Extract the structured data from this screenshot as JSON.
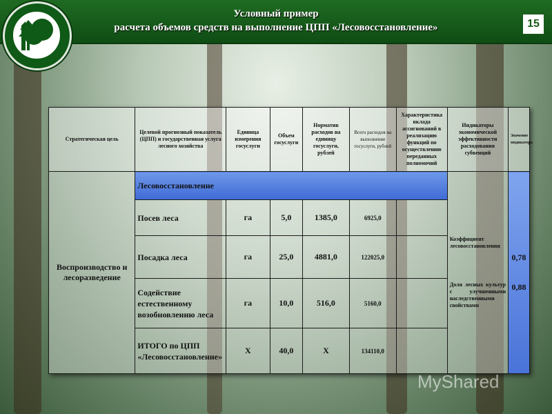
{
  "header": {
    "title_line1": "Условный пример",
    "title_line2": "расчета объемов средств на выполнение  ЦПП «Лесовосстановление»",
    "page_number": "15"
  },
  "table": {
    "columns": [
      "Стратегическая цель",
      "Целевой прогнозный показатель (ЦПП) и государственная услуга лесного хозяйства",
      "Единица измерения госуслуги",
      "Объем госуслуги",
      "Норматив расходов на единицу госуслуги, рублей",
      "Всего расходов на выполнение госуслуги, рублей",
      "Характеристика вклада ассигнований в реализацию функций по осуществлению переданных полномочий",
      "Индикаторы экономической эффективности расходования субвенций",
      "Значение индикатора"
    ],
    "goal": "Воспроизводство и лесоразведение",
    "section_title": "Лесовосстановление",
    "rows": [
      {
        "name": "Посев  леса",
        "unit": "га",
        "volume": "5,0",
        "norm": "1385,0",
        "total": "6925,0"
      },
      {
        "name": "Посадка леса",
        "unit": "га",
        "volume": "25,0",
        "norm": "4881,0",
        "total": "122025,0"
      },
      {
        "name": "Содействие естественному возобновлению леса",
        "unit": "га",
        "volume": "10,0",
        "norm": "516,0",
        "total": "5160,0"
      },
      {
        "name": "ИТОГО по ЦПП «Лесовосстановление»",
        "unit": "Х",
        "volume": "40,0",
        "norm": "Х",
        "total": "134110,0"
      }
    ],
    "indicators": [
      {
        "label": "Коэффициент лесовосстановления",
        "value": "0,78"
      },
      {
        "label": "Доля лесных культур с улучшенными наследственными свойствами",
        "value": "0,88"
      }
    ]
  },
  "watermark": "MyShared",
  "colors": {
    "header": "#1f6b22",
    "section": "#4a73d9"
  }
}
